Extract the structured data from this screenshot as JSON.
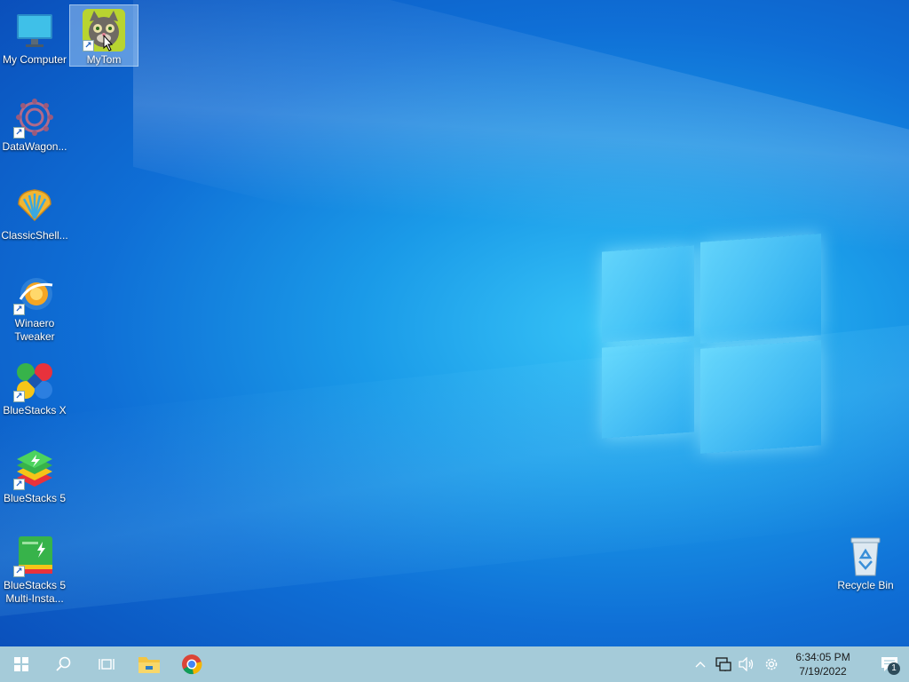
{
  "desktop": {
    "icons": [
      {
        "label": "My Computer",
        "icon": "monitor-icon"
      },
      {
        "label": "MyTom",
        "icon": "talking-tom-icon"
      },
      {
        "label": "DataWagon...",
        "icon": "datawagon-icon"
      },
      {
        "label": "ClassicShell...",
        "icon": "classic-shell-icon"
      },
      {
        "label": "Winaero\nTweaker",
        "icon": "winaero-tweaker-icon"
      },
      {
        "label": "BlueStacks X",
        "icon": "bluestacks-x-icon"
      },
      {
        "label": "BlueStacks 5",
        "icon": "bluestacks-5-icon"
      },
      {
        "label": "BlueStacks 5\nMulti-Insta...",
        "icon": "bluestacks-multi-instance-icon"
      },
      {
        "label": "Recycle Bin",
        "icon": "recycle-bin-icon"
      }
    ]
  },
  "taskbar": {
    "start": "windows-start-icon",
    "search": "search-icon",
    "task_view": "task-view-icon",
    "pinned": [
      "file-explorer-icon",
      "chrome-icon"
    ],
    "tray": {
      "icons": [
        "chevron-up-icon",
        "network-icon",
        "volume-icon",
        "settings-gear-icon"
      ],
      "time": "6:34:05 PM",
      "date": "7/19/2022",
      "notification_count": "1"
    }
  },
  "colors": {
    "taskbar_bg": "#a5cbd9",
    "wallpaper_accent": "#1a9ae8"
  }
}
